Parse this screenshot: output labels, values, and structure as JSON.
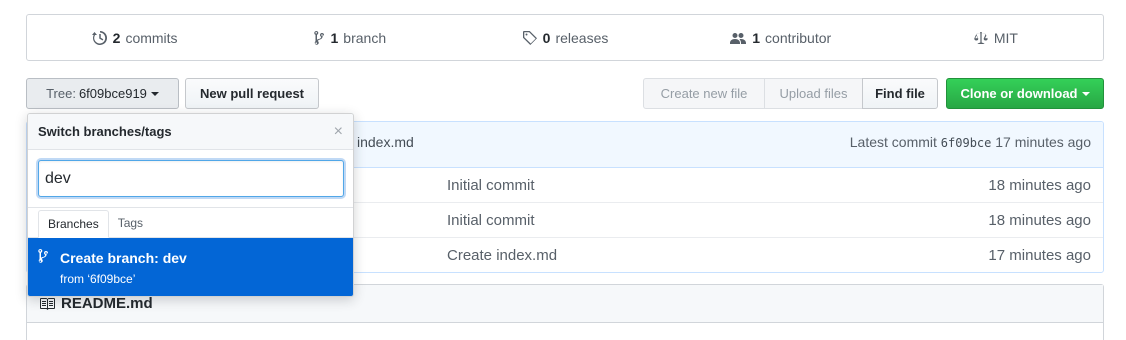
{
  "summary": {
    "commits": {
      "num": "2",
      "label": "commits",
      "icon": "history-icon"
    },
    "branches": {
      "num": "1",
      "label": "branch",
      "icon": "git-branch-icon"
    },
    "releases": {
      "num": "0",
      "label": "releases",
      "icon": "tag-icon"
    },
    "contributors": {
      "num": "1",
      "label": "contributor",
      "icon": "people-icon"
    },
    "license": {
      "label": "MIT",
      "icon": "law-icon"
    }
  },
  "toolbar": {
    "tree_label": "Tree:",
    "tree_value": "6f09bce919",
    "new_pr": "New pull request",
    "create_file": "Create new file",
    "upload_files": "Upload files",
    "find_file": "Find file",
    "clone": "Clone or download"
  },
  "commit_tease": {
    "message": "index.md",
    "latest_label": "Latest commit",
    "sha": "6f09bce",
    "age": "17 minutes ago"
  },
  "files": [
    {
      "message": "Initial commit",
      "age": "18 minutes ago"
    },
    {
      "message": "Initial commit",
      "age": "18 minutes ago"
    },
    {
      "message": "Create index.md",
      "age": "17 minutes ago"
    }
  ],
  "readme": {
    "title": "README.md",
    "icon": "book-icon"
  },
  "dropdown": {
    "header": "Switch branches/tags",
    "close": "×",
    "filter_value": "dev",
    "tabs": {
      "branches": "Branches",
      "tags": "Tags"
    },
    "create_title": "Create branch: dev",
    "create_from": "from ‘6f09bce’"
  },
  "colors": {
    "primary": "#0366d6",
    "clone_green": "#28a745"
  }
}
